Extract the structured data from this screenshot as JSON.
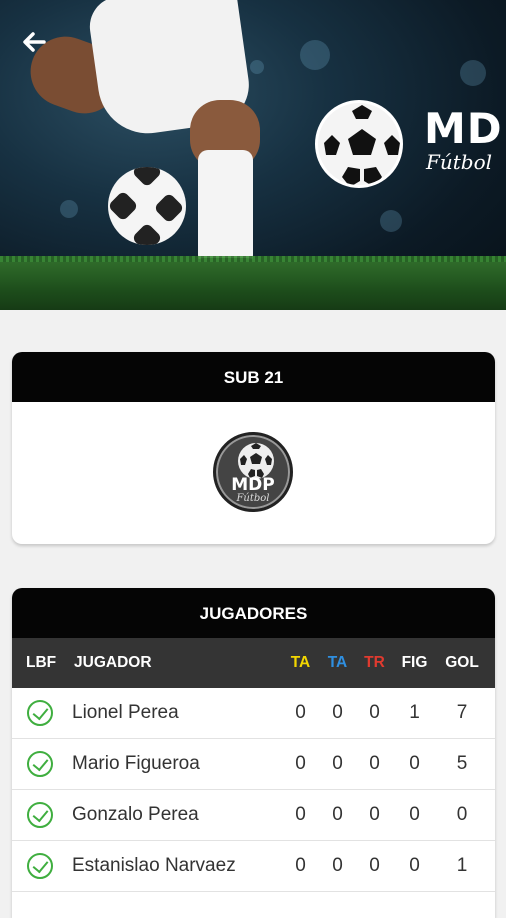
{
  "brand": {
    "logo_text": "MDP",
    "logo_sub": "Fútbol"
  },
  "category_card": {
    "title": "SUB 21",
    "team_logo_text": "MDP",
    "team_logo_sub": "Fútbol"
  },
  "players_card": {
    "title": "JUGADORES",
    "columns": [
      {
        "label": "LBF",
        "color": "#ffffff"
      },
      {
        "label": "JUGADOR",
        "color": "#ffffff"
      },
      {
        "label": "TA",
        "color": "#f2d600"
      },
      {
        "label": "TA",
        "color": "#2f8fe0"
      },
      {
        "label": "TR",
        "color": "#e03a2f"
      },
      {
        "label": "FIG",
        "color": "#ffffff"
      },
      {
        "label": "GOL",
        "color": "#ffffff"
      }
    ],
    "rows": [
      {
        "name": "Lionel Perea",
        "ta_yellow": "0",
        "ta_blue": "0",
        "tr": "0",
        "fig": "1",
        "gol": "7",
        "lbf_check": true
      },
      {
        "name": "Mario Figueroa",
        "ta_yellow": "0",
        "ta_blue": "0",
        "tr": "0",
        "fig": "0",
        "gol": "5",
        "lbf_check": true
      },
      {
        "name": "Gonzalo Perea",
        "ta_yellow": "0",
        "ta_blue": "0",
        "tr": "0",
        "fig": "0",
        "gol": "0",
        "lbf_check": true
      },
      {
        "name": "Estanislao Narvaez",
        "ta_yellow": "0",
        "ta_blue": "0",
        "tr": "0",
        "fig": "0",
        "gol": "1",
        "lbf_check": true
      }
    ]
  },
  "icons": {
    "back": "arrow-left-icon",
    "check": "check-circle-icon"
  }
}
